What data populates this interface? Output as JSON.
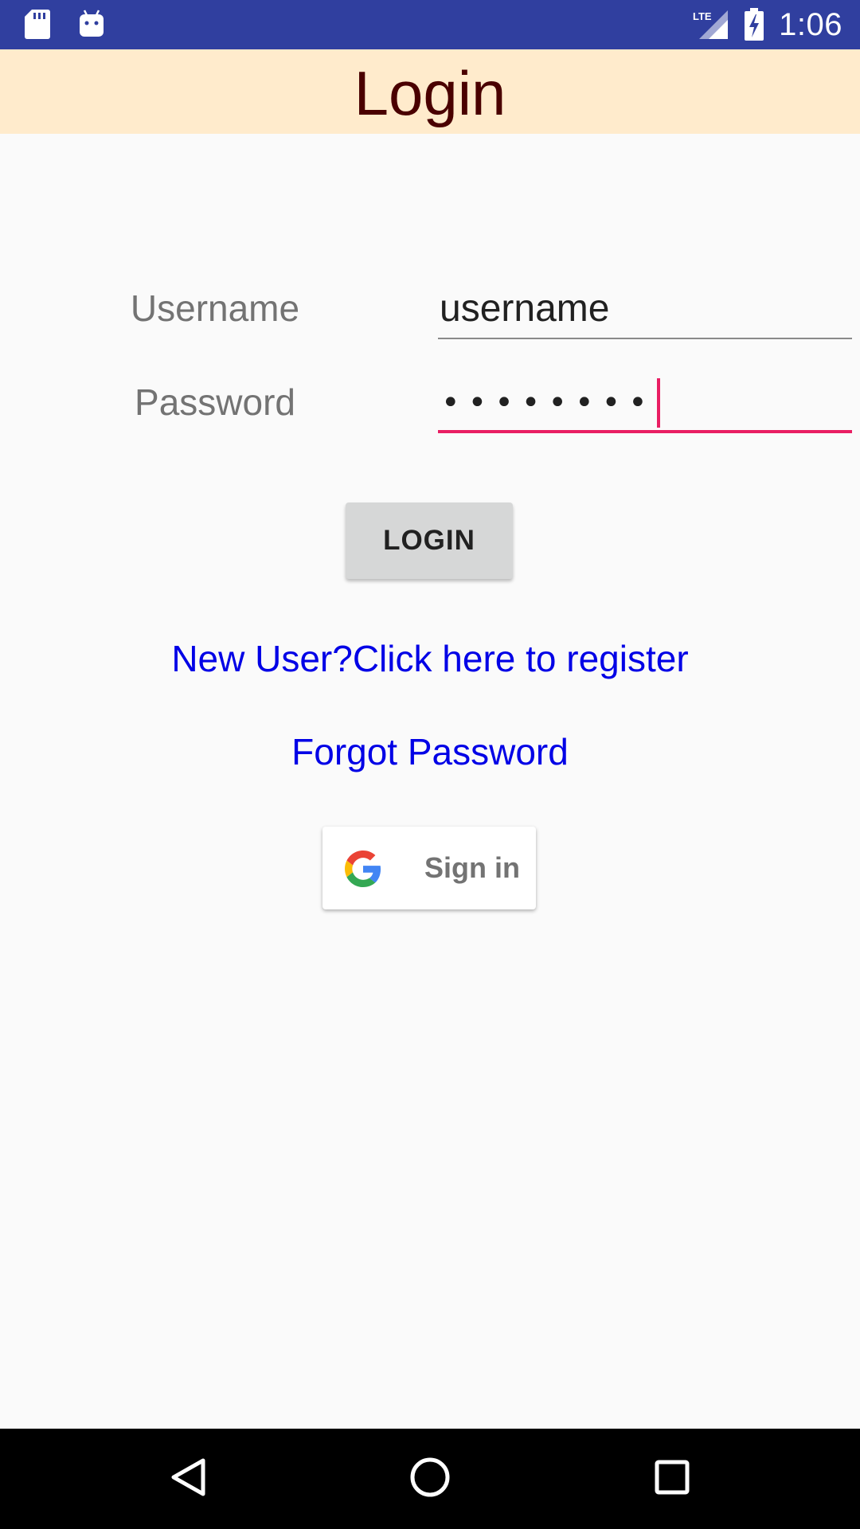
{
  "status_bar": {
    "time": "1:06",
    "network": "LTE",
    "icons": [
      "sd-card-icon",
      "android-icon",
      "lte-signal-icon",
      "battery-charging-icon"
    ]
  },
  "header": {
    "title": "Login"
  },
  "form": {
    "username_label": "Username",
    "username_value": "username",
    "password_label": "Password",
    "password_masked": "••••••••"
  },
  "actions": {
    "login_label": "LOGIN",
    "register_link": "New User?Click here to register",
    "forgot_link": "Forgot Password",
    "google_signin_label": "Sign in"
  },
  "nav_bar": {
    "icons": [
      "back-icon",
      "home-icon",
      "recents-icon"
    ]
  },
  "colors": {
    "status_bar": "#303f9f",
    "title_bar": "#ffebcc",
    "title_text": "#4a0000",
    "accent": "#e91e63",
    "link": "#0000e6"
  }
}
